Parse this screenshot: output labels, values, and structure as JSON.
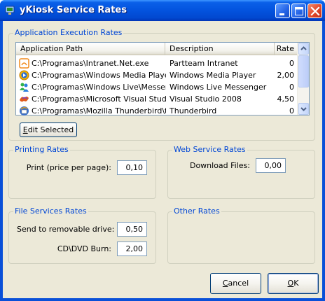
{
  "window": {
    "title": "yKiosk Service Rates"
  },
  "app_exec": {
    "title": "Application Execution Rates",
    "columns": [
      "Application Path",
      "Description",
      "Rate"
    ],
    "rows": [
      {
        "path": "C:\\Programas\\Intranet.Net.exe",
        "description": "Partteam Intranet",
        "rate": "0",
        "icon": "intranet-icon"
      },
      {
        "path": "C:\\Programas\\Windows Media Player...",
        "description": "Windows Media Player",
        "rate": "2,00",
        "icon": "media-player-icon"
      },
      {
        "path": "C:\\Programas\\Windows Live\\Messen...",
        "description": "Windows Live Messenger",
        "rate": "0",
        "icon": "messenger-icon"
      },
      {
        "path": "C:\\Programas\\Microsoft Visual Studio...",
        "description": "Visual Studio 2008",
        "rate": "4,50",
        "icon": "visual-studio-icon"
      },
      {
        "path": "C:\\Programas\\Mozilla Thunderbird\\th...",
        "description": "Thunderbird",
        "rate": "0",
        "icon": "thunderbird-icon"
      }
    ],
    "edit_button": {
      "pre": "",
      "mnemonic": "E",
      "post": "dit Selected"
    }
  },
  "printing": {
    "title": "Printing Rates",
    "print_label": "Print (price per page):",
    "print_value": "0,10"
  },
  "web": {
    "title": "Web Service Rates",
    "download_label": "Download Files:",
    "download_value": "0,00"
  },
  "file_services": {
    "title": "File Services Rates",
    "removable_label": "Send to removable drive:",
    "removable_value": "0,50",
    "burn_label": "CD\\DVD Burn:",
    "burn_value": "2,00"
  },
  "other": {
    "title": "Other Rates"
  },
  "buttons": {
    "cancel": {
      "mnemonic": "C",
      "post": "ancel"
    },
    "ok": {
      "mnemonic": "O",
      "post": "K"
    }
  },
  "colors": {
    "group_title": "#0046d5",
    "face": "#ece9d8",
    "titlebar": "#0353de",
    "close_button": "#e0472a"
  }
}
